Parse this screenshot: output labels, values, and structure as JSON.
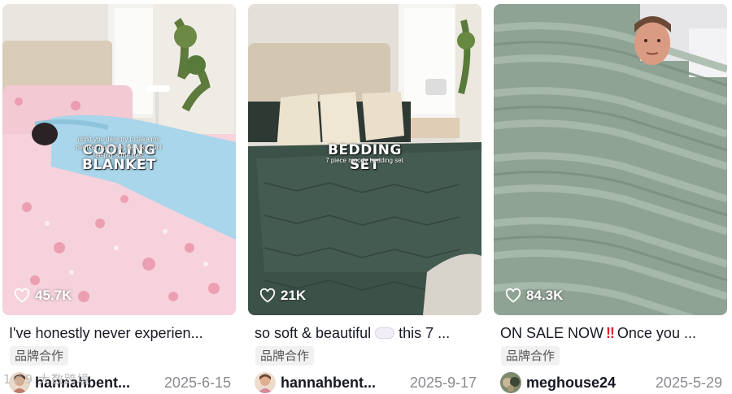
{
  "cards": [
    {
      "overlay_title": "COOLING BLANKET",
      "overlay_text": "don't you dare try to take my blanket from me the silky cool feeling is the best",
      "likes": "45.7K",
      "caption": "I've honestly never experien...",
      "tag": "品牌合作",
      "username": "hannahbent...",
      "date": "2025-6-15"
    },
    {
      "overlay_title": "BEDDING SET",
      "overlay_text": "7 piece moody bedding set",
      "likes": "21K",
      "caption_a": "so soft & beautiful",
      "caption_b": "this 7 ...",
      "tag": "品牌合作",
      "username": "hannahbent...",
      "date": "2025-9-17"
    },
    {
      "likes": "84.3K",
      "caption_a": "ON SALE NOW",
      "caption_bang": "‼",
      "caption_b": "Once you ...",
      "tag": "品牌合作",
      "username": "meghouse24",
      "date": "2025-5-29"
    }
  ],
  "watermark": "1©9 大数跨境",
  "colors": {
    "text": "#161823",
    "muted": "#8a8b91",
    "tag_bg": "#f1f1f2"
  },
  "icons": [
    "heart-icon",
    "cloud-emoji-icon",
    "double-exclamation-icon"
  ]
}
